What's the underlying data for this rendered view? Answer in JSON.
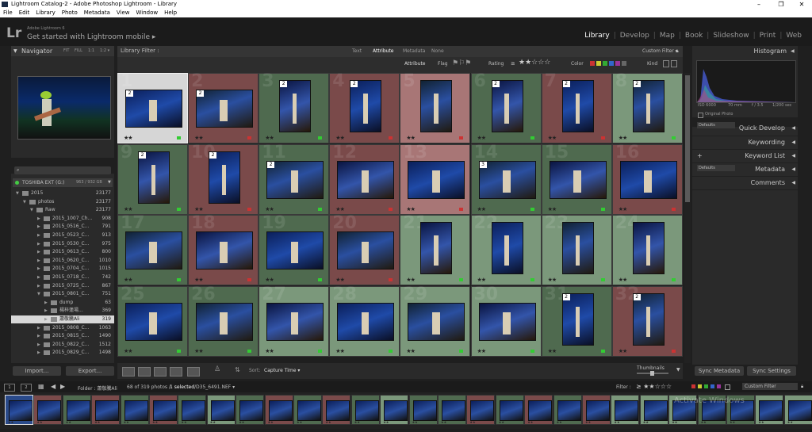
{
  "window": {
    "title": "Lightroom Catalog-2 - Adobe Photoshop Lightroom - Library",
    "menu": [
      "File",
      "Edit",
      "Library",
      "Photo",
      "Metadata",
      "View",
      "Window",
      "Help"
    ]
  },
  "identity": {
    "logo": "Lr",
    "sub": "Adobe Lightroom 6",
    "main": "Get started with Lightroom mobile ▸"
  },
  "modules": [
    "Library",
    "Develop",
    "Map",
    "Book",
    "Slideshow",
    "Print",
    "Web"
  ],
  "navigator": {
    "title": "Navigator",
    "zoom": [
      "FIT",
      "FILL",
      "1:1",
      "1:2 ▾"
    ]
  },
  "folders": {
    "search_placeholder": "",
    "volume": "TOSHIBA EXT (G:)",
    "volume_size": "963 / 932 GB",
    "rows": [
      {
        "label": "2015",
        "count": "23177",
        "depth": 0,
        "open": true
      },
      {
        "label": "photos",
        "count": "23177",
        "depth": 1,
        "open": true
      },
      {
        "label": "Raw",
        "count": "23177",
        "depth": 2,
        "open": true
      },
      {
        "label": "2015_1007_Ch...",
        "count": "908",
        "depth": 3
      },
      {
        "label": "2015_0516_C...",
        "count": "791",
        "depth": 3
      },
      {
        "label": "2015_0523_C...",
        "count": "913",
        "depth": 3
      },
      {
        "label": "2015_0530_C...",
        "count": "975",
        "depth": 3
      },
      {
        "label": "2015_0613_C...",
        "count": "800",
        "depth": 3
      },
      {
        "label": "2015_0620_C...",
        "count": "1010",
        "depth": 3
      },
      {
        "label": "2015_0704_C...",
        "count": "1015",
        "depth": 3
      },
      {
        "label": "2015_0718_C...",
        "count": "742",
        "depth": 3
      },
      {
        "label": "2015_0725_C...",
        "count": "867",
        "depth": 3
      },
      {
        "label": "2015_0801_C...",
        "count": "751",
        "depth": 3,
        "open": true
      },
      {
        "label": "dump",
        "count": "63",
        "depth": 4
      },
      {
        "label": "楊梓蓮場...",
        "count": "369",
        "depth": 4
      },
      {
        "label": "蕭敬騰Ali",
        "count": "319",
        "depth": 4,
        "selected": true
      },
      {
        "label": "2015_0808_C...",
        "count": "1063",
        "depth": 3
      },
      {
        "label": "2015_0815_C...",
        "count": "1490",
        "depth": 3
      },
      {
        "label": "2015_0822_C...",
        "count": "1512",
        "depth": 3
      },
      {
        "label": "2015_0829_C...",
        "count": "1498",
        "depth": 3
      }
    ]
  },
  "left_buttons": {
    "import": "Import...",
    "export": "Export..."
  },
  "library_filter": {
    "label": "Library Filter :",
    "tabs": [
      "Text",
      "Attribute",
      "Metadata",
      "None"
    ],
    "custom": "Custom Filter ▾",
    "attribute": "Attribute",
    "flag": "Flag",
    "rating": "Rating",
    "rating_op": "≥",
    "rating_stars": "★★☆☆☆",
    "color": "Color",
    "kind": "Kind"
  },
  "grid": {
    "cells": [
      {
        "n": 1,
        "bg": "#d6d6d6",
        "stars": "★★",
        "thumb": "h",
        "flag": "#3c3",
        "badge": "2",
        "sel": true
      },
      {
        "n": 2,
        "bg": "#7a4a4a",
        "stars": "★★",
        "thumb": "h",
        "flag": "#c33",
        "badge": "2"
      },
      {
        "n": 3,
        "bg": "#4f6a4f",
        "stars": "★★",
        "thumb": "v",
        "flag": "#3c3",
        "badge": "2"
      },
      {
        "n": 4,
        "bg": "#7a4a4a",
        "stars": "★★",
        "thumb": "v",
        "flag": "#c33",
        "badge": "2"
      },
      {
        "n": 5,
        "bg": "#a87676",
        "stars": "★★",
        "thumb": "v",
        "flag": "#c33"
      },
      {
        "n": 6,
        "bg": "#4f6a4f",
        "stars": "★★",
        "thumb": "v",
        "flag": "#3c3",
        "badge": "2"
      },
      {
        "n": 7,
        "bg": "#7a4a4a",
        "stars": "★★",
        "thumb": "v",
        "flag": "#c33",
        "badge": "2"
      },
      {
        "n": 8,
        "bg": "#7b987b",
        "stars": "★★",
        "thumb": "v",
        "flag": "#3c3",
        "badge": "2"
      },
      {
        "n": 9,
        "bg": "#4f6a4f",
        "stars": "★★",
        "thumb": "v",
        "flag": "#3c3",
        "badge": "2"
      },
      {
        "n": 10,
        "bg": "#7a4a4a",
        "stars": "★★",
        "thumb": "v",
        "flag": "#c33",
        "badge": "2"
      },
      {
        "n": 11,
        "bg": "#4f6a4f",
        "stars": "★★",
        "thumb": "h",
        "flag": "#3c3",
        "badge": "2"
      },
      {
        "n": 12,
        "bg": "#7a4a4a",
        "stars": "★★",
        "thumb": "h",
        "flag": "#c33"
      },
      {
        "n": 13,
        "bg": "#a87676",
        "stars": "★★",
        "thumb": "h",
        "flag": "#c33"
      },
      {
        "n": 14,
        "bg": "#4f6a4f",
        "stars": "★★",
        "thumb": "h",
        "flag": "#3c3",
        "badge": "3"
      },
      {
        "n": 15,
        "bg": "#4f6a4f",
        "stars": "★★",
        "thumb": "h",
        "flag": "#3c3"
      },
      {
        "n": 16,
        "bg": "#7a4a4a",
        "stars": "★★",
        "thumb": "h",
        "flag": "#c33"
      },
      {
        "n": 17,
        "bg": "#4f6a4f",
        "stars": "★★",
        "thumb": "h",
        "flag": "#3c3"
      },
      {
        "n": 18,
        "bg": "#7a4a4a",
        "stars": "★★",
        "thumb": "h",
        "flag": "#c33"
      },
      {
        "n": 19,
        "bg": "#4f6a4f",
        "stars": "★★",
        "thumb": "h",
        "flag": "#3c3"
      },
      {
        "n": 20,
        "bg": "#7a4a4a",
        "stars": "★★",
        "thumb": "h",
        "flag": "#c33"
      },
      {
        "n": 21,
        "bg": "#7b987b",
        "stars": "★★",
        "thumb": "v",
        "flag": "#3c3"
      },
      {
        "n": 22,
        "bg": "#7b987b",
        "stars": "★★",
        "thumb": "v",
        "flag": "#3c3"
      },
      {
        "n": 23,
        "bg": "#7b987b",
        "stars": "★★",
        "thumb": "v",
        "flag": "#3c3"
      },
      {
        "n": 24,
        "bg": "#7b987b",
        "stars": "★★",
        "thumb": "v",
        "flag": "#3c3"
      },
      {
        "n": 25,
        "bg": "#4f6a4f",
        "stars": "★★",
        "thumb": "h",
        "flag": "#3c3"
      },
      {
        "n": 26,
        "bg": "#4f6a4f",
        "stars": "★★",
        "thumb": "h",
        "flag": "#3c3"
      },
      {
        "n": 27,
        "bg": "#7b987b",
        "stars": "★★",
        "thumb": "h",
        "flag": "#3c3"
      },
      {
        "n": 28,
        "bg": "#7b987b",
        "stars": "★★",
        "thumb": "h",
        "flag": "#3c3"
      },
      {
        "n": 29,
        "bg": "#7b987b",
        "stars": "★★",
        "thumb": "h",
        "flag": "#3c3"
      },
      {
        "n": 30,
        "bg": "#7b987b",
        "stars": "★★",
        "thumb": "h",
        "flag": "#3c3"
      },
      {
        "n": 31,
        "bg": "#4f6a4f",
        "stars": "★★",
        "thumb": "v",
        "flag": "#3c3",
        "badge": "2"
      },
      {
        "n": 32,
        "bg": "#7a4a4a",
        "stars": "★★",
        "thumb": "v",
        "flag": "#c33",
        "badge": "2"
      }
    ]
  },
  "toolbar": {
    "sort_label": "Sort:",
    "sort_value": "Capture Time ▾",
    "thumbnails": "Thumbnails"
  },
  "right_panel": {
    "histogram": "Histogram",
    "exif": [
      "ISO 6000",
      "70 mm",
      "f / 3.5",
      "1/200 sec"
    ],
    "original_photo": "Original Photo",
    "preset_defaults": "Defaults",
    "sections": [
      "Quick Develop",
      "Keywording",
      "Keyword List",
      "Metadata",
      "Comments"
    ],
    "sync_metadata": "Sync Metadata",
    "sync_settings": "Sync Settings"
  },
  "filmstrip": {
    "pages": [
      "1",
      "2"
    ],
    "folder": "Folder : 蕭敬騰Ali",
    "count": "68 of 319 photos /",
    "selected": "1 selected",
    "file": "/D35_6491.NEF ▾",
    "filter_label": "Filter :",
    "filter_stars": "≥ ★★☆☆☆",
    "custom": "Custom Filter",
    "watermark": "Activate Windows",
    "thumbs": [
      "#2a4a8a",
      "#7a4a4a",
      "#4f6a4f",
      "#7a4a4a",
      "#4f6a4f",
      "#7a4a4a",
      "#4f6a4f",
      "#7b987b",
      "#4f6a4f",
      "#7a4a4a",
      "#4f6a4f",
      "#7a4a4a",
      "#4f6a4f",
      "#7b987b",
      "#4f6a4f",
      "#4f6a4f",
      "#7a4a4a",
      "#4f6a4f",
      "#7a4a4a",
      "#4f6a4f",
      "#7a4a4a",
      "#7b987b",
      "#7b987b",
      "#7b987b",
      "#4f6a4f",
      "#4f6a4f",
      "#7b987b",
      "#7b987b"
    ]
  }
}
